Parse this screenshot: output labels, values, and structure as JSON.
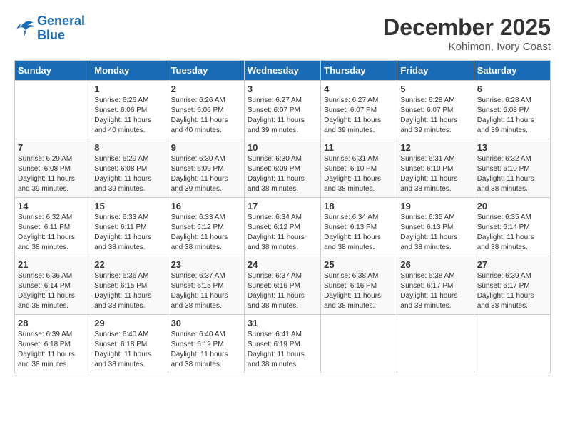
{
  "logo": {
    "line1": "General",
    "line2": "Blue"
  },
  "title": "December 2025",
  "location": "Kohimon, Ivory Coast",
  "weekdays": [
    "Sunday",
    "Monday",
    "Tuesday",
    "Wednesday",
    "Thursday",
    "Friday",
    "Saturday"
  ],
  "days": [
    {
      "date": null
    },
    {
      "date": 1,
      "sunrise": "6:26 AM",
      "sunset": "6:06 PM",
      "daylight": "11 hours and 40 minutes."
    },
    {
      "date": 2,
      "sunrise": "6:26 AM",
      "sunset": "6:06 PM",
      "daylight": "11 hours and 40 minutes."
    },
    {
      "date": 3,
      "sunrise": "6:27 AM",
      "sunset": "6:07 PM",
      "daylight": "11 hours and 39 minutes."
    },
    {
      "date": 4,
      "sunrise": "6:27 AM",
      "sunset": "6:07 PM",
      "daylight": "11 hours and 39 minutes."
    },
    {
      "date": 5,
      "sunrise": "6:28 AM",
      "sunset": "6:07 PM",
      "daylight": "11 hours and 39 minutes."
    },
    {
      "date": 6,
      "sunrise": "6:28 AM",
      "sunset": "6:08 PM",
      "daylight": "11 hours and 39 minutes."
    },
    {
      "date": 7,
      "sunrise": "6:29 AM",
      "sunset": "6:08 PM",
      "daylight": "11 hours and 39 minutes."
    },
    {
      "date": 8,
      "sunrise": "6:29 AM",
      "sunset": "6:08 PM",
      "daylight": "11 hours and 39 minutes."
    },
    {
      "date": 9,
      "sunrise": "6:30 AM",
      "sunset": "6:09 PM",
      "daylight": "11 hours and 39 minutes."
    },
    {
      "date": 10,
      "sunrise": "6:30 AM",
      "sunset": "6:09 PM",
      "daylight": "11 hours and 38 minutes."
    },
    {
      "date": 11,
      "sunrise": "6:31 AM",
      "sunset": "6:10 PM",
      "daylight": "11 hours and 38 minutes."
    },
    {
      "date": 12,
      "sunrise": "6:31 AM",
      "sunset": "6:10 PM",
      "daylight": "11 hours and 38 minutes."
    },
    {
      "date": 13,
      "sunrise": "6:32 AM",
      "sunset": "6:10 PM",
      "daylight": "11 hours and 38 minutes."
    },
    {
      "date": 14,
      "sunrise": "6:32 AM",
      "sunset": "6:11 PM",
      "daylight": "11 hours and 38 minutes."
    },
    {
      "date": 15,
      "sunrise": "6:33 AM",
      "sunset": "6:11 PM",
      "daylight": "11 hours and 38 minutes."
    },
    {
      "date": 16,
      "sunrise": "6:33 AM",
      "sunset": "6:12 PM",
      "daylight": "11 hours and 38 minutes."
    },
    {
      "date": 17,
      "sunrise": "6:34 AM",
      "sunset": "6:12 PM",
      "daylight": "11 hours and 38 minutes."
    },
    {
      "date": 18,
      "sunrise": "6:34 AM",
      "sunset": "6:13 PM",
      "daylight": "11 hours and 38 minutes."
    },
    {
      "date": 19,
      "sunrise": "6:35 AM",
      "sunset": "6:13 PM",
      "daylight": "11 hours and 38 minutes."
    },
    {
      "date": 20,
      "sunrise": "6:35 AM",
      "sunset": "6:14 PM",
      "daylight": "11 hours and 38 minutes."
    },
    {
      "date": 21,
      "sunrise": "6:36 AM",
      "sunset": "6:14 PM",
      "daylight": "11 hours and 38 minutes."
    },
    {
      "date": 22,
      "sunrise": "6:36 AM",
      "sunset": "6:15 PM",
      "daylight": "11 hours and 38 minutes."
    },
    {
      "date": 23,
      "sunrise": "6:37 AM",
      "sunset": "6:15 PM",
      "daylight": "11 hours and 38 minutes."
    },
    {
      "date": 24,
      "sunrise": "6:37 AM",
      "sunset": "6:16 PM",
      "daylight": "11 hours and 38 minutes."
    },
    {
      "date": 25,
      "sunrise": "6:38 AM",
      "sunset": "6:16 PM",
      "daylight": "11 hours and 38 minutes."
    },
    {
      "date": 26,
      "sunrise": "6:38 AM",
      "sunset": "6:17 PM",
      "daylight": "11 hours and 38 minutes."
    },
    {
      "date": 27,
      "sunrise": "6:39 AM",
      "sunset": "6:17 PM",
      "daylight": "11 hours and 38 minutes."
    },
    {
      "date": 28,
      "sunrise": "6:39 AM",
      "sunset": "6:18 PM",
      "daylight": "11 hours and 38 minutes."
    },
    {
      "date": 29,
      "sunrise": "6:40 AM",
      "sunset": "6:18 PM",
      "daylight": "11 hours and 38 minutes."
    },
    {
      "date": 30,
      "sunrise": "6:40 AM",
      "sunset": "6:19 PM",
      "daylight": "11 hours and 38 minutes."
    },
    {
      "date": 31,
      "sunrise": "6:41 AM",
      "sunset": "6:19 PM",
      "daylight": "11 hours and 38 minutes."
    }
  ],
  "labels": {
    "sunrise": "Sunrise:",
    "sunset": "Sunset:",
    "daylight": "Daylight:"
  }
}
